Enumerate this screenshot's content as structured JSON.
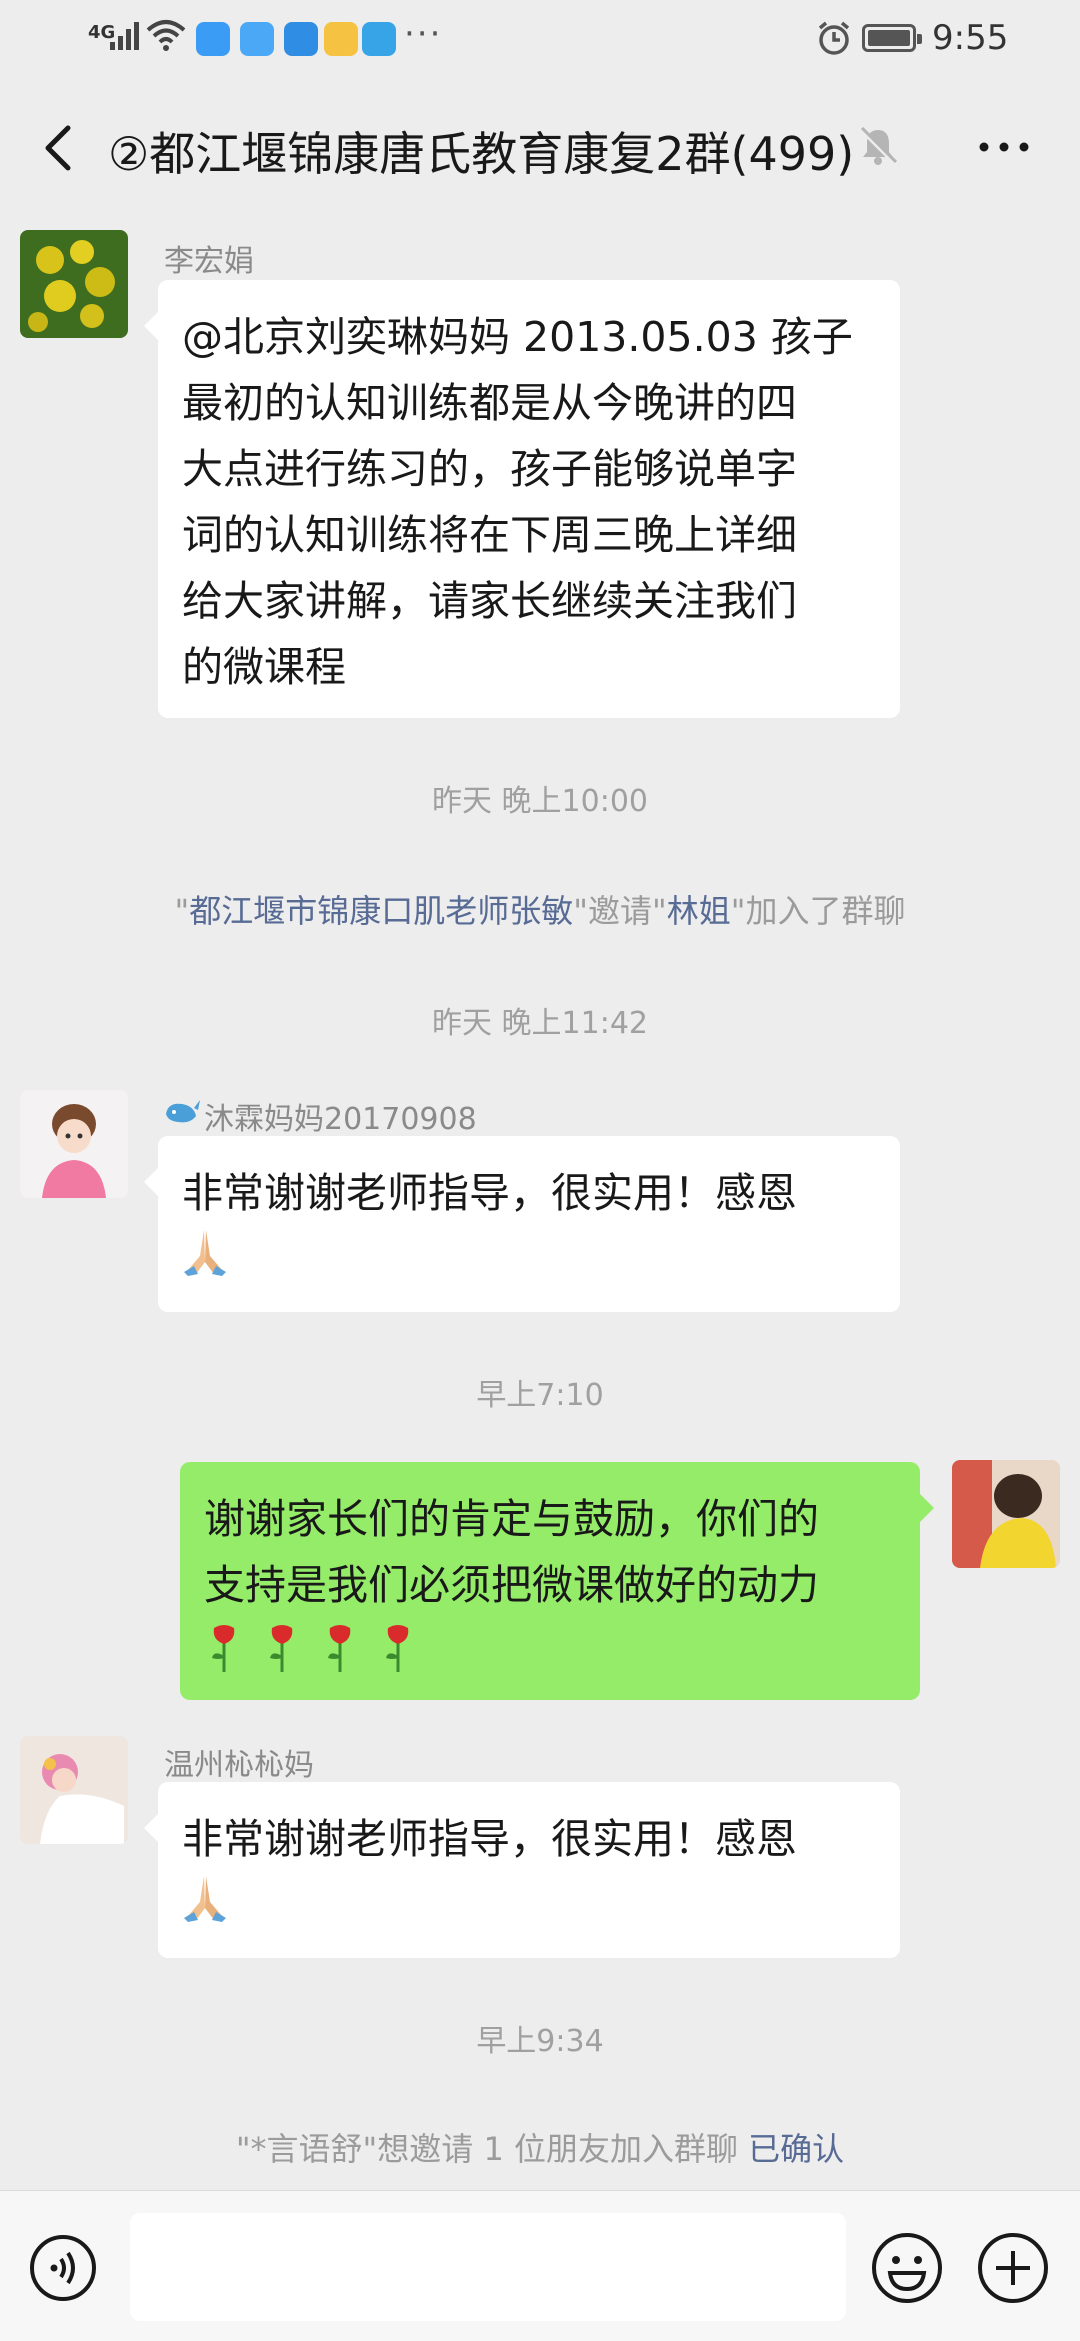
{
  "status_bar": {
    "network": "4G",
    "time": "9:55"
  },
  "header": {
    "title": "②都江堰锦康唐氏教育康复2群(499)"
  },
  "messages": [
    {
      "sender": "李宏娟",
      "lines": [
        "@北京刘奕琳妈妈 2013.05.03  孩子",
        "最初的认知训练都是从今晚讲的四",
        "大点进行练习的，孩子能够说单字",
        "词的认知训练将在下周三晚上详细",
        "给大家讲解，请家长继续关注我们",
        "的微课程"
      ]
    },
    {
      "sender": "沐霖妈妈20170908",
      "lines": [
        "非常谢谢老师指导，很实用！感恩"
      ]
    },
    {
      "lines": [
        "谢谢家长们的肯定与鼓励，你们的",
        "支持是我们必须把微课做好的动力"
      ]
    },
    {
      "sender": "温州杺杺妈",
      "lines": [
        "非常谢谢老师指导，很实用！感恩"
      ]
    }
  ],
  "timestamps": [
    "昨天 晚上10:00",
    "昨天 晚上11:42",
    "早上7:10",
    "早上9:34"
  ],
  "system": {
    "invite1": {
      "q1": "\"",
      "inviter": "都江堰市锦康口肌老师张敏",
      "mid1": "\"邀请\"",
      "invitee": "林姐",
      "tail": "\"加入了群聊"
    },
    "invite2": {
      "text": "\"*言语舒\"想邀请 1 位朋友加入群聊 ",
      "confirm": "已确认"
    }
  },
  "colors": {
    "background": "#ededed",
    "own_bubble": "#95ec69",
    "link": "#576b95"
  },
  "icons": [
    "back-arrow-icon",
    "mute-bell-icon",
    "more-dots-icon",
    "voice-icon",
    "emoji-icon",
    "plus-icon",
    "pray-emoji",
    "rose-emoji"
  ]
}
